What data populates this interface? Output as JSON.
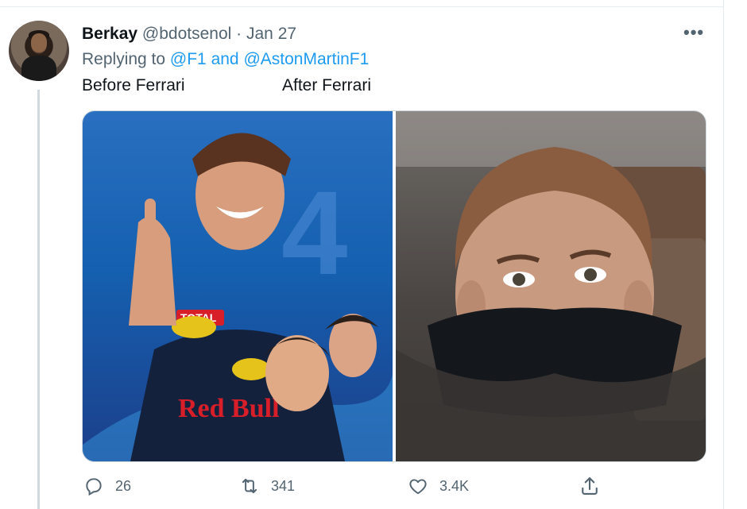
{
  "tweet": {
    "author_name": "Berkay",
    "handle": "@bdotsenol",
    "separator": "·",
    "date": "Jan 27",
    "more": "•••",
    "replying_prefix": "Replying to ",
    "mentions": "@F1 and @AstonMartinF1",
    "text_before": "Before Ferrari",
    "text_after": "After Ferrari"
  },
  "media": {
    "left_image": {
      "description_icon": "photo",
      "logo_text": "Red Bull",
      "badge_text": "TOTAL",
      "number_text": "4"
    },
    "right_image": {
      "description_icon": "photo"
    }
  },
  "actions": {
    "reply_count": "26",
    "retweet_count": "341",
    "like_count": "3.4K"
  },
  "colors": {
    "link": "#1d9bf0",
    "secondary_text": "#536471",
    "primary_text": "#0f1419",
    "border": "#cfd9de"
  },
  "icons": {
    "reply": "reply-icon",
    "retweet": "retweet-icon",
    "like": "heart-icon",
    "share": "share-icon",
    "more": "more-icon"
  }
}
